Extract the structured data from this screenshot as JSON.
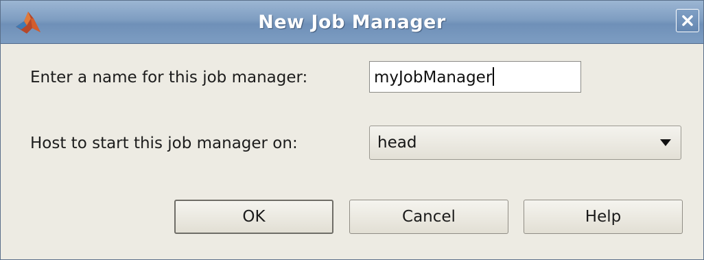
{
  "window": {
    "title": "New Job Manager",
    "app_icon": "matlab-logo-icon",
    "close_icon": "close-icon"
  },
  "form": {
    "name_label": "Enter a name for this job manager:",
    "name_value": "myJobManager",
    "host_label": "Host to start this job manager on:",
    "host_value": "head",
    "host_dropdown_icon": "triangle-down-icon"
  },
  "buttons": {
    "ok_label": "OK",
    "cancel_label": "Cancel",
    "help_label": "Help"
  },
  "colors": {
    "titlebar": "#7e9dc1",
    "background": "#edebe3"
  }
}
